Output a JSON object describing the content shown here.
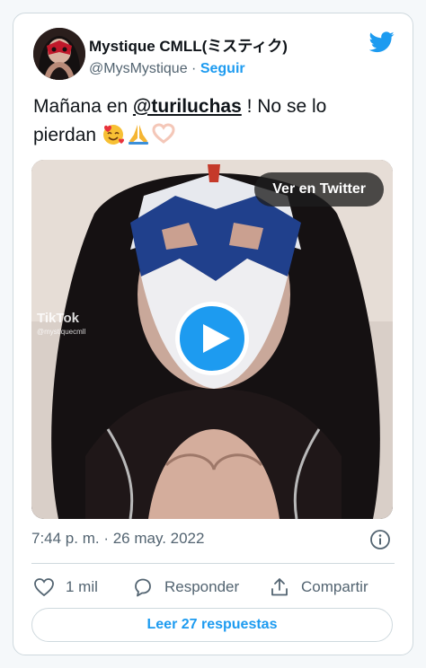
{
  "tweet": {
    "author_name": "Mystique CMLL(ミスティク)",
    "handle": "@MysMystique",
    "separator": "·",
    "follow_label": "Seguir",
    "text_before": "Mañana en ",
    "mention": "@turiluchas",
    "text_after": " ! No se lo pierdan ",
    "emojis": [
      "smiling-face-with-hearts",
      "folded-hands",
      "heart-hands"
    ],
    "timestamp": "7:44 p. m. · 26 may. 2022"
  },
  "media": {
    "watch_button_label": "Ver en Twitter",
    "tiktok_logo": "TikTok",
    "tiktok_user": "@mystiquecmll"
  },
  "actions": {
    "like_count": "1 mil",
    "reply_label": "Responder",
    "share_label": "Compartir"
  },
  "footer": {
    "read_replies_label": "Leer 27 respuestas"
  },
  "colors": {
    "accent": "#1d9bf0",
    "text": "#0f1419",
    "muted": "#536471",
    "border": "#cfd9de"
  }
}
